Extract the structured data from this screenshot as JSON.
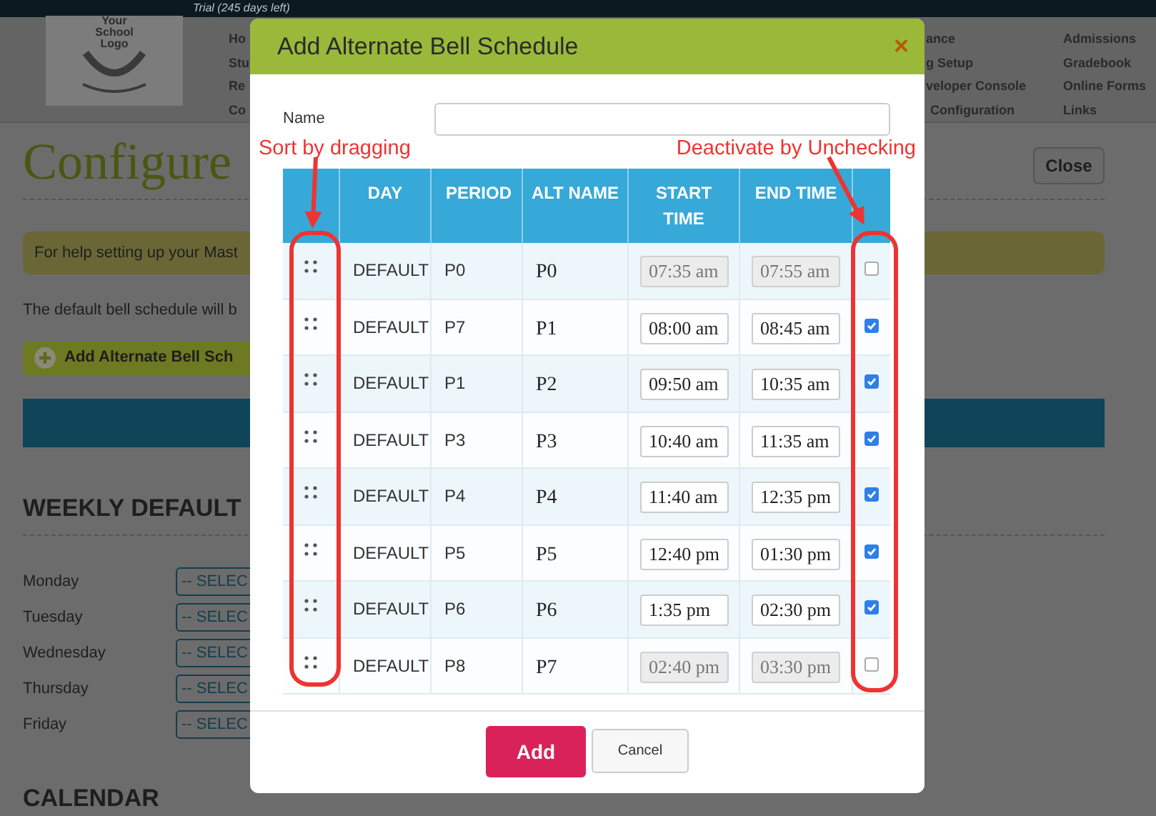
{
  "background": {
    "trial_note": "Trial (245 days left)",
    "logo_text": "Your School Logo",
    "nav_left": [
      "Ho",
      "Stu",
      "Re",
      "Co"
    ],
    "nav_right": [
      "ance",
      "g Setup",
      "veloper Console",
      "Configuration"
    ],
    "nav_far": [
      "Admissions",
      "Gradebook",
      "Online Forms",
      "Links"
    ],
    "page_title": "Configure",
    "close_button": "Close",
    "help_banner": "For help setting up your Mast",
    "description": "The default bell schedule will b",
    "add_button": "Add Alternate Bell Sch",
    "weekly_heading": "WEEKLY DEFAULT",
    "days": [
      {
        "label": "Monday",
        "select": "-- SELEC"
      },
      {
        "label": "Tuesday",
        "select": "-- SELEC"
      },
      {
        "label": "Wednesday",
        "select": "-- SELEC"
      },
      {
        "label": "Thursday",
        "select": "-- SELEC"
      },
      {
        "label": "Friday",
        "select": "-- SELEC"
      }
    ],
    "calendar_heading": "CALENDAR"
  },
  "modal": {
    "title": "Add Alternate Bell Schedule",
    "close": "×",
    "name_label": "Name",
    "annotations": [
      "Sort by dragging",
      "Deactivate by Unchecking"
    ],
    "columns": [
      "DAY",
      "PERIOD",
      "ALT NAME",
      "START TIME",
      "END TIME"
    ],
    "rows": [
      {
        "day": "DEFAULT",
        "period": "P0",
        "alt_name": "P0",
        "start": "07:35 am",
        "end": "07:55 am",
        "checked": false
      },
      {
        "day": "DEFAULT",
        "period": "P7",
        "alt_name": "P1",
        "start": "08:00 am",
        "end": "08:45 am",
        "checked": true
      },
      {
        "day": "DEFAULT",
        "period": "P1",
        "alt_name": "P2",
        "start": "09:50 am",
        "end": "10:35 am",
        "checked": true
      },
      {
        "day": "DEFAULT",
        "period": "P3",
        "alt_name": "P3",
        "start": "10:40 am",
        "end": "11:35 am",
        "checked": true
      },
      {
        "day": "DEFAULT",
        "period": "P4",
        "alt_name": "P4",
        "start": "11:40 am",
        "end": "12:35 pm",
        "checked": true
      },
      {
        "day": "DEFAULT",
        "period": "P5",
        "alt_name": "P5",
        "start": "12:40 pm",
        "end": "01:30 pm",
        "checked": true
      },
      {
        "day": "DEFAULT",
        "period": "P6",
        "alt_name": "P6",
        "start": "1:35 pm",
        "end": "02:30 pm",
        "checked": true
      },
      {
        "day": "DEFAULT",
        "period": "P8",
        "alt_name": "P7",
        "start": "02:40 pm",
        "end": "03:30 pm",
        "checked": false
      }
    ],
    "buttons": {
      "add": "Add",
      "cancel": "Cancel"
    }
  }
}
